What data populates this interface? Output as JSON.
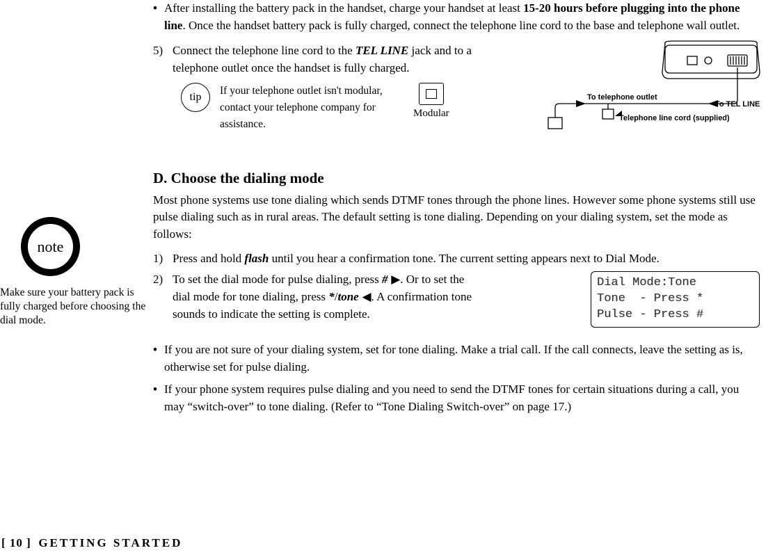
{
  "sidebar": {
    "note_label": "note",
    "note_text": "Make sure your battery pack is fully charged before choosing the dial mode."
  },
  "main": {
    "bullet1_pre": "After installing the battery pack in the handset, charge your handset at least ",
    "bullet1_bold": "15-20 hours before plugging into the phone line",
    "bullet1_post": ". Once the handset battery pack is fully charged, connect the telephone line cord to the base and telephone wall outlet.",
    "step5_num": "5)",
    "step5_a": "Connect the telephone line cord to the ",
    "step5_jack": "TEL LINE",
    "step5_b": " jack and to a telephone outlet once the handset is fully charged.",
    "tip_label": "tip",
    "tip_text": "If your telephone outlet isn't modular, contact your telephone company for assistance.",
    "modular_label": "Modular",
    "diagram": {
      "to_outlet": "To telephone outlet",
      "cord_supplied": "Telephone line cord (supplied)",
      "to_tel_line": "To TEL LINE"
    },
    "headingD": "D. Choose the dialing mode",
    "d_intro": "Most phone systems use tone dialing which sends DTMF tones through the phone lines. However some phone systems still use pulse dialing such as in rural areas. The default setting is tone dialing. Depending on your dialing system, set the mode as follows:",
    "step1_num": "1)",
    "step1_a": "Press and hold ",
    "step1_flash": "flash",
    "step1_b": " until you hear a confirmation tone. The current setting appears next to Dial Mode.",
    "step2_num": "2)",
    "step2_a": "To set the dial mode for pulse dialing, press ",
    "step2_hash": "#",
    "step2_arrow_r": " ▶",
    "step2_b": ". Or to set the dial mode for tone dialing, press ",
    "step2_star": "*",
    "step2_slash": "/",
    "step2_tone": "tone",
    "step2_arrow_l": " ◀",
    "step2_c": ". A confirmation tone sounds to indicate the setting is complete.",
    "lcd_line1": "Dial Mode:Tone",
    "lcd_line2": "Tone  - Press *",
    "lcd_line3": "Pulse - Press #",
    "bullet2": "If you are not sure of your dialing system, set for tone dialing. Make a trial call. If the call connects, leave the setting as is, otherwise set for pulse dialing.",
    "bullet3": "If your phone system requires pulse dialing and you need to send the DTMF tones for certain situations during a call, you may “switch-over” to tone dialing. (Refer to “Tone Dialing Switch-over” on page 17.)"
  },
  "footer": {
    "page_num": "[ 10 ]",
    "section": "GETTING STARTED"
  }
}
